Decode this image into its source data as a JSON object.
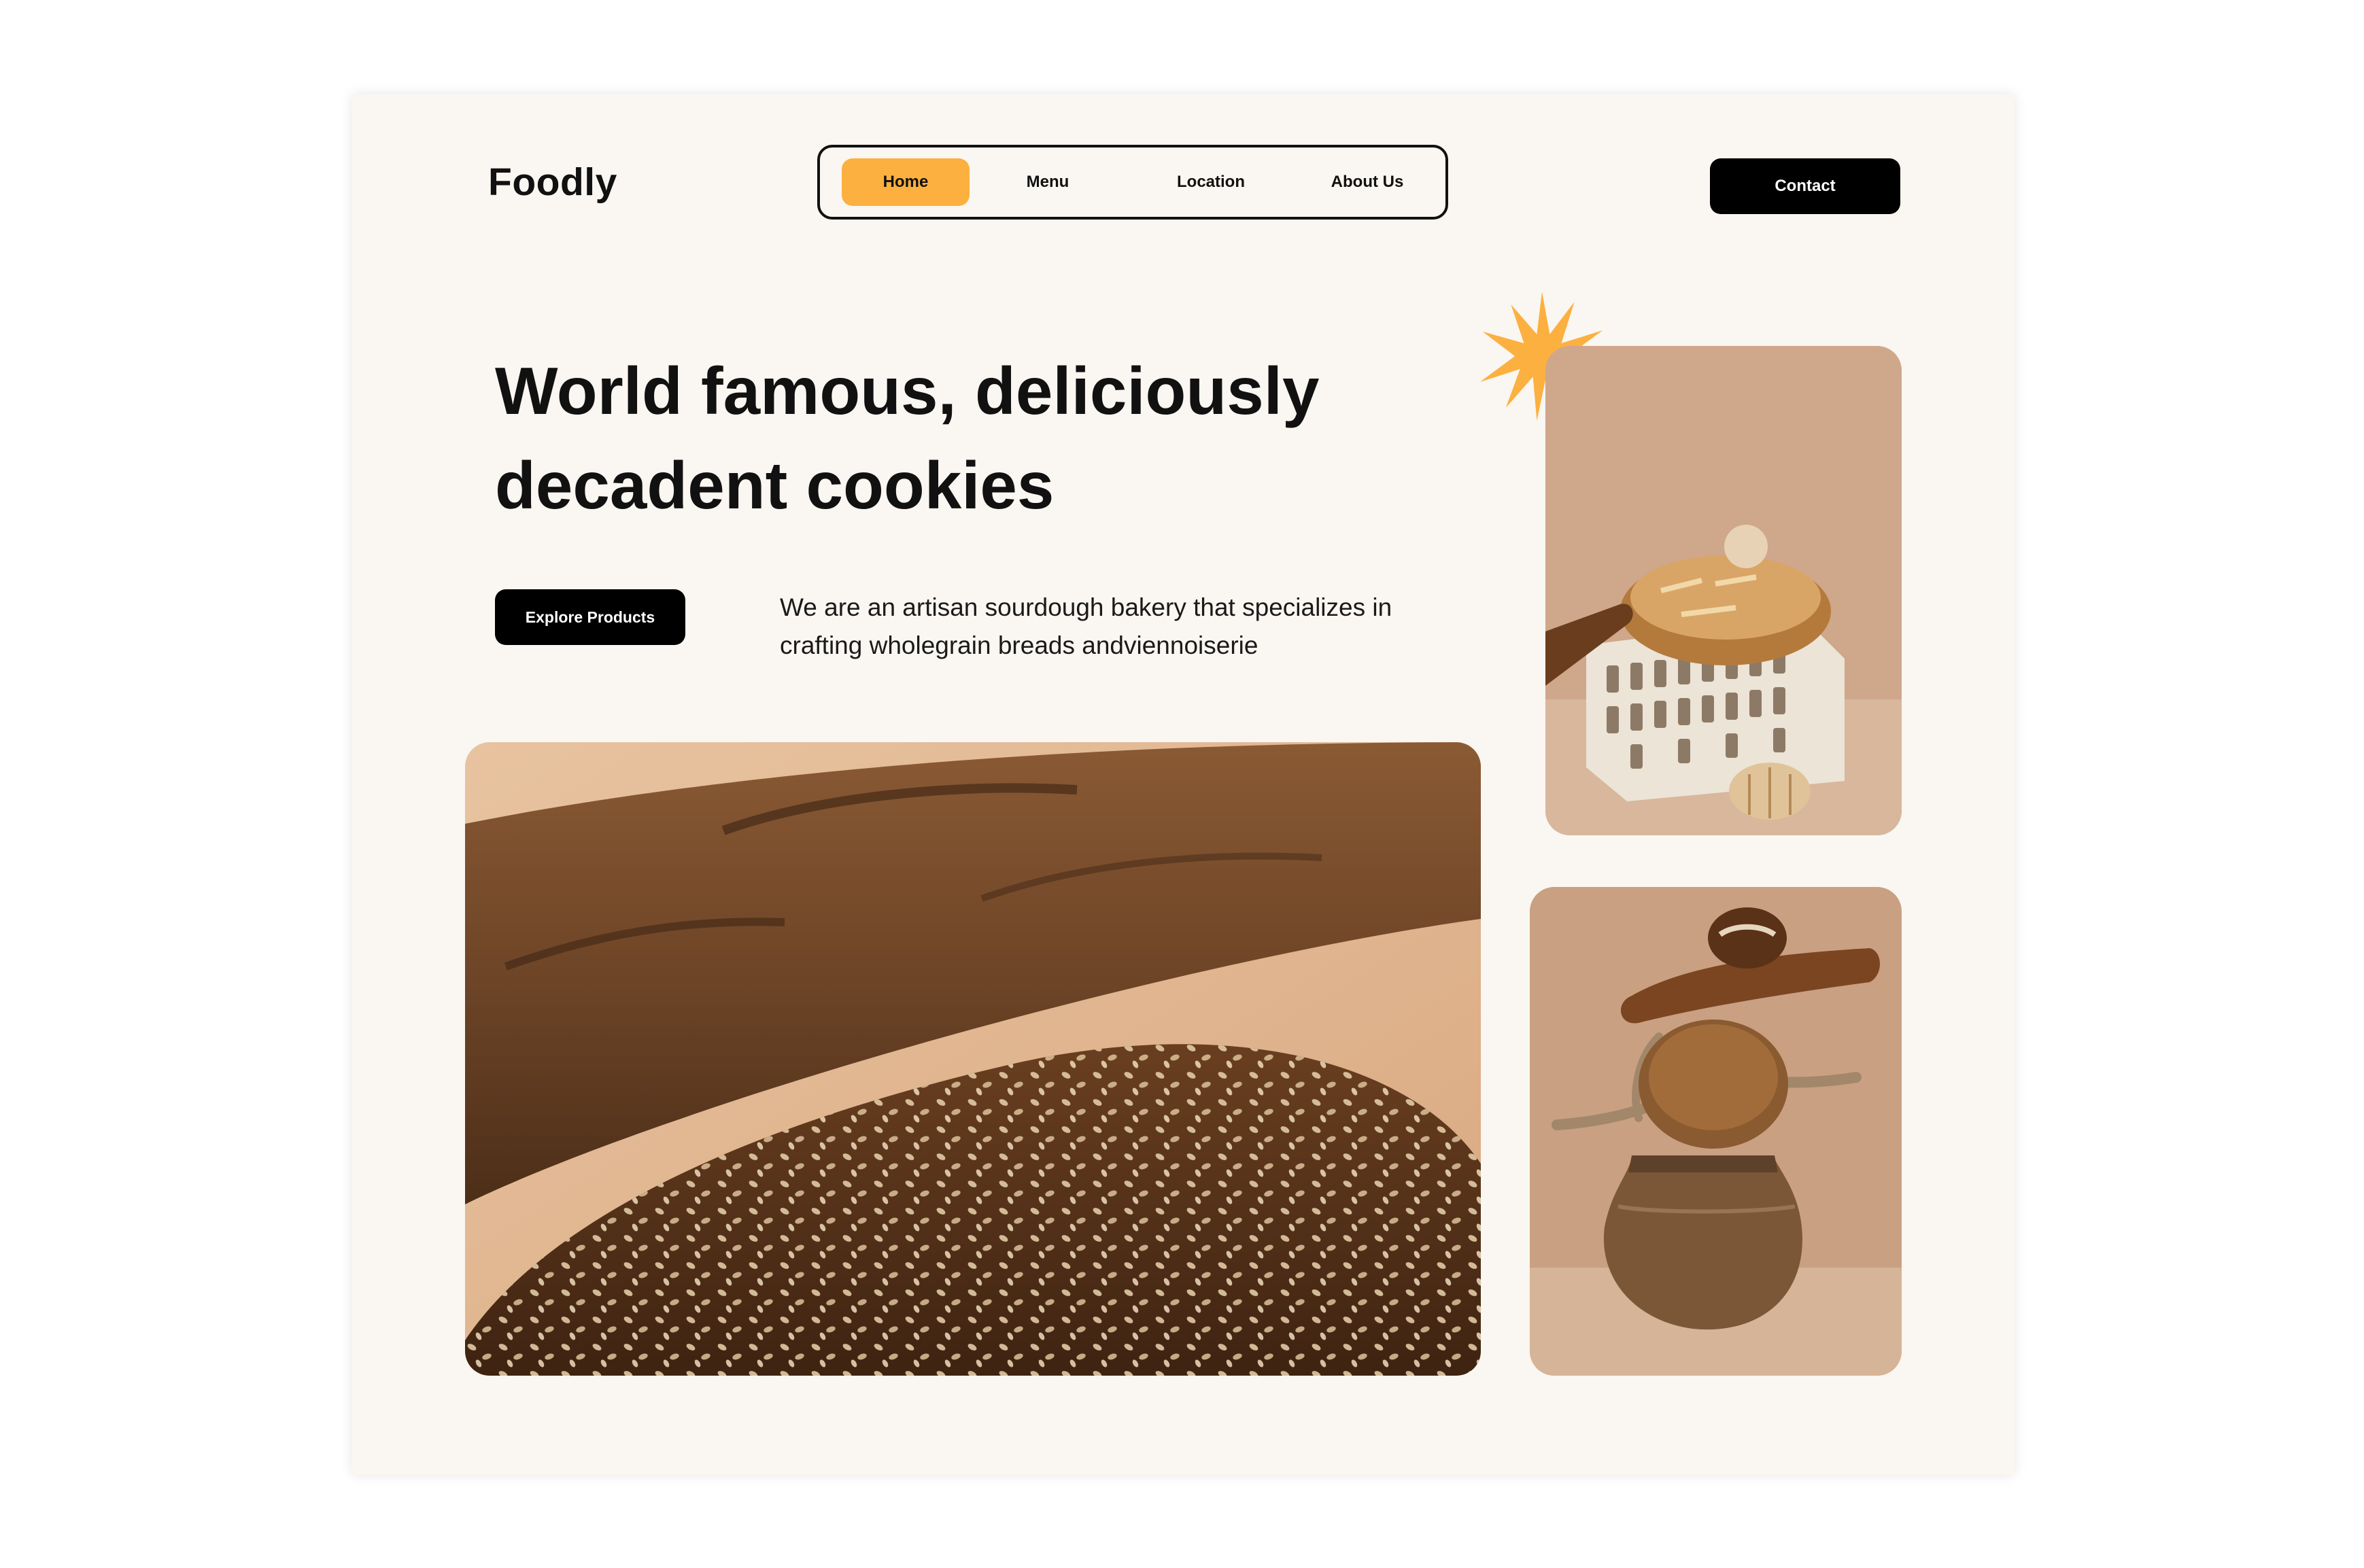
{
  "brand": {
    "name": "Foodly"
  },
  "nav": {
    "items": [
      {
        "label": "Home",
        "active": true
      },
      {
        "label": "Menu",
        "active": false
      },
      {
        "label": "Location",
        "active": false
      },
      {
        "label": "About Us",
        "active": false
      }
    ]
  },
  "header": {
    "contact_label": "Contact"
  },
  "hero": {
    "headline_line1": "World famous, deliciously",
    "headline_line2": "decadent cookies",
    "cta_label": "Explore Products",
    "tagline_line1": "We are an artisan sourdough bakery that specializes in",
    "tagline_line2": "crafting wholegrain breads andviennoiserie"
  },
  "images": {
    "main": "baguettes-with-sesame-seeds-photo",
    "side_top": "bread-on-brick-photo",
    "side_bottom": "bread-stacked-on-clay-pot-photo"
  },
  "icons": {
    "star": "starburst-icon"
  },
  "colors": {
    "accent": "#fcb040",
    "background": "#faf6f1",
    "button_dark": "#000000",
    "text": "#111111"
  }
}
